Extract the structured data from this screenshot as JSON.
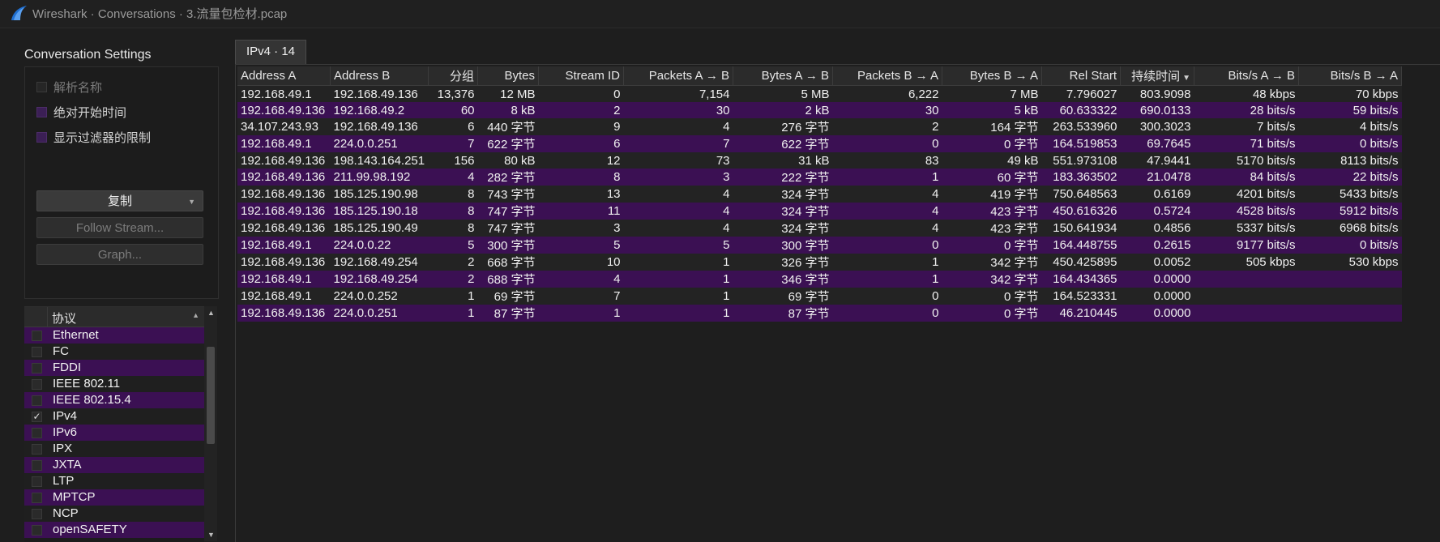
{
  "window": {
    "title": "Wireshark · Conversations · 3.流量包检材.pcap"
  },
  "settings": {
    "label": "Conversation Settings",
    "name_resolution": "解析名称",
    "absolute_start": "绝对开始时间",
    "limit_to_filter": "显示过滤器的限制",
    "copy_label": "复制",
    "follow_stream_label": "Follow Stream...",
    "graph_label": "Graph..."
  },
  "protocols": {
    "header": "协议",
    "items": [
      {
        "label": "Ethernet",
        "checked": ""
      },
      {
        "label": "FC",
        "checked": ""
      },
      {
        "label": "FDDI",
        "checked": ""
      },
      {
        "label": "IEEE 802.11",
        "checked": ""
      },
      {
        "label": "IEEE 802.15.4",
        "checked": ""
      },
      {
        "label": "IPv4",
        "checked": "✓"
      },
      {
        "label": "IPv6",
        "checked": ""
      },
      {
        "label": "IPX",
        "checked": ""
      },
      {
        "label": "JXTA",
        "checked": ""
      },
      {
        "label": "LTP",
        "checked": ""
      },
      {
        "label": "MPTCP",
        "checked": ""
      },
      {
        "label": "NCP",
        "checked": ""
      },
      {
        "label": "openSAFETY",
        "checked": ""
      }
    ]
  },
  "tab": {
    "label": "IPv4 · 14"
  },
  "table": {
    "columns": [
      "Address A",
      "Address B",
      "分组",
      "Bytes",
      "Stream ID",
      "Packets A → B",
      "Bytes A → B",
      "Packets B → A",
      "Bytes B → A",
      "Rel Start",
      "持续时间",
      "Bits/s A → B",
      "Bits/s B → A"
    ],
    "sort_indicator": "▼",
    "rows": [
      [
        "192.168.49.1",
        "192.168.49.136",
        "13,376",
        "12 MB",
        "0",
        "7,154",
        "5 MB",
        "6,222",
        "7 MB",
        "7.796027",
        "803.9098",
        "48 kbps",
        "70 kbps"
      ],
      [
        "192.168.49.136",
        "192.168.49.2",
        "60",
        "8 kB",
        "2",
        "30",
        "2 kB",
        "30",
        "5 kB",
        "60.633322",
        "690.0133",
        "28 bits/s",
        "59 bits/s"
      ],
      [
        "34.107.243.93",
        "192.168.49.136",
        "6",
        "440 字节",
        "9",
        "4",
        "276 字节",
        "2",
        "164 字节",
        "263.533960",
        "300.3023",
        "7 bits/s",
        "4 bits/s"
      ],
      [
        "192.168.49.1",
        "224.0.0.251",
        "7",
        "622 字节",
        "6",
        "7",
        "622 字节",
        "0",
        "0 字节",
        "164.519853",
        "69.7645",
        "71 bits/s",
        "0 bits/s"
      ],
      [
        "192.168.49.136",
        "198.143.164.251",
        "156",
        "80 kB",
        "12",
        "73",
        "31 kB",
        "83",
        "49 kB",
        "551.973108",
        "47.9441",
        "5170 bits/s",
        "8113 bits/s"
      ],
      [
        "192.168.49.136",
        "211.99.98.192",
        "4",
        "282 字节",
        "8",
        "3",
        "222 字节",
        "1",
        "60 字节",
        "183.363502",
        "21.0478",
        "84 bits/s",
        "22 bits/s"
      ],
      [
        "192.168.49.136",
        "185.125.190.98",
        "8",
        "743 字节",
        "13",
        "4",
        "324 字节",
        "4",
        "419 字节",
        "750.648563",
        "0.6169",
        "4201 bits/s",
        "5433 bits/s"
      ],
      [
        "192.168.49.136",
        "185.125.190.18",
        "8",
        "747 字节",
        "11",
        "4",
        "324 字节",
        "4",
        "423 字节",
        "450.616326",
        "0.5724",
        "4528 bits/s",
        "5912 bits/s"
      ],
      [
        "192.168.49.136",
        "185.125.190.49",
        "8",
        "747 字节",
        "3",
        "4",
        "324 字节",
        "4",
        "423 字节",
        "150.641934",
        "0.4856",
        "5337 bits/s",
        "6968 bits/s"
      ],
      [
        "192.168.49.1",
        "224.0.0.22",
        "5",
        "300 字节",
        "5",
        "5",
        "300 字节",
        "0",
        "0 字节",
        "164.448755",
        "0.2615",
        "9177 bits/s",
        "0 bits/s"
      ],
      [
        "192.168.49.136",
        "192.168.49.254",
        "2",
        "668 字节",
        "10",
        "1",
        "326 字节",
        "1",
        "342 字节",
        "450.425895",
        "0.0052",
        "505 kbps",
        "530 kbps"
      ],
      [
        "192.168.49.1",
        "192.168.49.254",
        "2",
        "688 字节",
        "4",
        "1",
        "346 字节",
        "1",
        "342 字节",
        "164.434365",
        "0.0000",
        "",
        ""
      ],
      [
        "192.168.49.1",
        "224.0.0.252",
        "1",
        "69 字节",
        "7",
        "1",
        "69 字节",
        "0",
        "0 字节",
        "164.523331",
        "0.0000",
        "",
        ""
      ],
      [
        "192.168.49.136",
        "224.0.0.251",
        "1",
        "87 字节",
        "1",
        "1",
        "87 字节",
        "0",
        "0 字节",
        "46.210445",
        "0.0000",
        "",
        ""
      ]
    ]
  },
  "colors": {
    "row_alt": "#3b1053",
    "row": "#232323",
    "background": "#1e1e1e",
    "accent": "#1f6fd1"
  }
}
